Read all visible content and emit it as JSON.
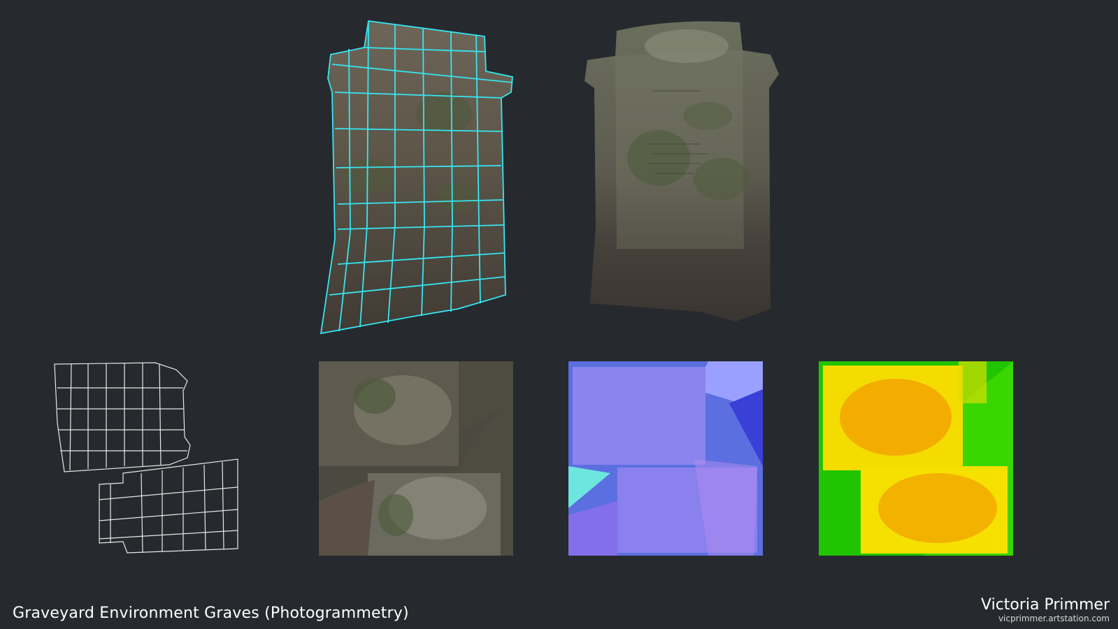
{
  "caption": {
    "title": "Graveyard Environment Graves (Photogrammetry)",
    "artist": "Victoria Primmer",
    "website": "vicprimmer.artstation.com"
  },
  "panels": [
    {
      "id": "wireframe-render",
      "icon": "gravestone-wireframe-render"
    },
    {
      "id": "textured-render",
      "icon": "gravestone-textured-render"
    },
    {
      "id": "uv-layout",
      "icon": "uv-layout-wireframe"
    },
    {
      "id": "albedo-map",
      "icon": "albedo-texture-map"
    },
    {
      "id": "normal-map",
      "icon": "normal-texture-map"
    },
    {
      "id": "ao-map",
      "icon": "ambient-occlusion-texture-map"
    }
  ],
  "colors": {
    "background": "#262a2e",
    "wire_highlight": "#35e6f2",
    "stone": "#5a5448",
    "moss": "#4d5a3a",
    "normal": "#8a82f0",
    "ao_yellow": "#f4d400",
    "ao_green": "#29c800"
  }
}
